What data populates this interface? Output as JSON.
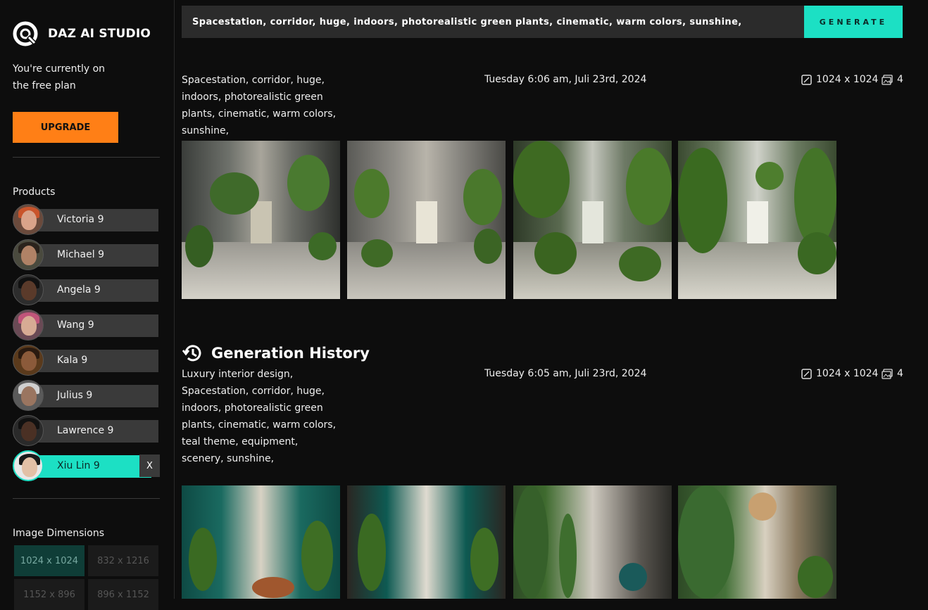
{
  "app": {
    "brand": "DAZ AI STUDIO",
    "plan_line1": "You're currently on",
    "plan_line2": "the free plan",
    "upgrade_label": "UPGRADE"
  },
  "sidebar": {
    "products_label": "Products",
    "products": [
      {
        "name": "Victoria 9"
      },
      {
        "name": "Michael 9"
      },
      {
        "name": "Angela 9"
      },
      {
        "name": "Wang 9"
      },
      {
        "name": "Kala 9"
      },
      {
        "name": "Julius 9"
      },
      {
        "name": "Lawrence 9"
      },
      {
        "name": "Xiu Lin 9",
        "selected": true
      }
    ],
    "remove_label": "X",
    "dimensions_label": "Image Dimensions",
    "dimensions": [
      "1024 x 1024",
      "832 x 1216",
      "1152 x 896",
      "896 x 1152"
    ],
    "selected_dimension": "1024 x 1024"
  },
  "prompt_bar": {
    "value": "Spacestation, corridor, huge, indoors, photorealistic green plants, cinematic, warm colors, sunshine,",
    "generate_label": "GENERATE"
  },
  "current": {
    "prompt": "Spacestation, corridor, huge, indoors, photorealistic green plants, cinematic, warm colors, sunshine,",
    "date": "Tuesday 6:06 am, Juli 23rd, 2024",
    "resolution": "1024 x 1024",
    "count": "4"
  },
  "history": {
    "title": "Generation History",
    "entries": [
      {
        "prompt": "Luxury interior design, Spacestation, corridor, huge, indoors, photorealistic green plants, cinematic, warm colors, teal theme, equipment, scenery, sunshine,",
        "date": "Tuesday 6:05 am, Juli 23rd, 2024",
        "resolution": "1024 x 1024",
        "count": "4"
      }
    ]
  },
  "colors": {
    "accent": "#1ce0c4",
    "upgrade": "#ff7f16",
    "background": "#0d0d0d"
  },
  "icons": [
    "daz-logo-icon",
    "resolution-icon",
    "images-count-icon",
    "history-icon"
  ]
}
